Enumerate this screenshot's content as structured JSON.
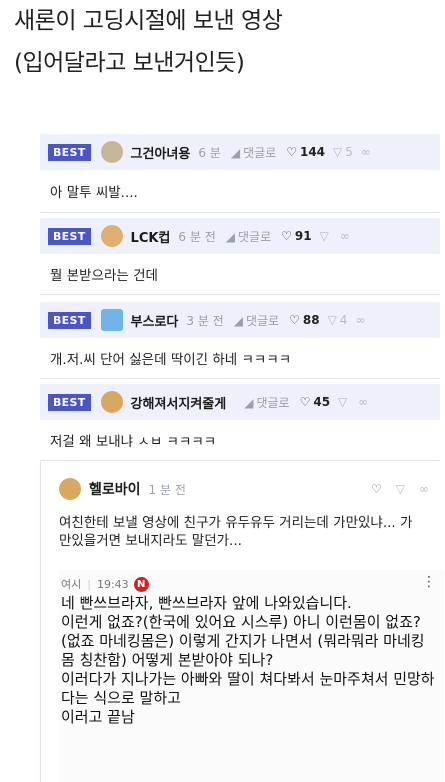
{
  "title": {
    "line1": "새론이 고딩시절에 보낸 영상",
    "line2": "(입어달라고 보낸거인듯)"
  },
  "comments": [
    {
      "best": "BEST",
      "nick": "그건아녀용",
      "time": "6 분",
      "reply": "댓글로",
      "likes": "144",
      "dislikes": "5",
      "avatar_color": "#c8b69a",
      "body": "아 말투 씨발...."
    },
    {
      "best": "BEST",
      "nick": "LCK컵",
      "time": "6 분 전",
      "reply": "댓글로",
      "likes": "91",
      "dislikes": "",
      "avatar_color": "#e0b070",
      "body": "뭘 본받으라는 건데"
    },
    {
      "best": "BEST",
      "nick": "부스로다",
      "time": "3 분 전",
      "reply": "댓글로",
      "likes": "88",
      "dislikes": "4",
      "avatar_color": "#6fb3e8",
      "body": "개.저.씨 단어 싫은데 딱이긴 하네 ㅋㅋㅋㅋ"
    },
    {
      "best": "BEST",
      "nick": "강해져서지켜줄게",
      "time": "",
      "reply": "댓글로",
      "likes": "45",
      "dislikes": "",
      "avatar_color": "#d9a860",
      "body": "저걸 왜 보내냐 ㅅㅂ ㅋㅋㅋㅋ"
    }
  ],
  "reply": {
    "nick": "헬로바이",
    "time": "1 분 전",
    "avatar_color": "#d9a860",
    "text": "여친한테 보낼 영상에 친구가 유두유두 거리는데 가만있냐... 가만있을거면 보내지라도 말던가...",
    "quote": {
      "source": "여시",
      "time": "19:43",
      "badge": "N",
      "more": "⋮",
      "text": "네 빤쓰브라자, 빤쓰브라자 앞에 나와있습니다.\n이런게 없죠?(한국에 있어요 시스루) 아니 이런몸이 없죠?(없죠 마네킹몸은) 이렇게 간지가 나면서 (뭐라뭐라 마네킹 몸 칭찬함) 어떻게 본받아야 되나?\n이러다가 지나가는 아빠와 딸이 쳐다봐서 눈마주쳐서 민망하다는 식으로 말하고\n이러고 끝남"
    }
  },
  "icons": {
    "reply": "↙",
    "like": "👍",
    "dislike": "👎",
    "share": "share-icon"
  },
  "colors": {
    "best_bg": "#4a55c8",
    "header_bg": "#eef0fb"
  }
}
